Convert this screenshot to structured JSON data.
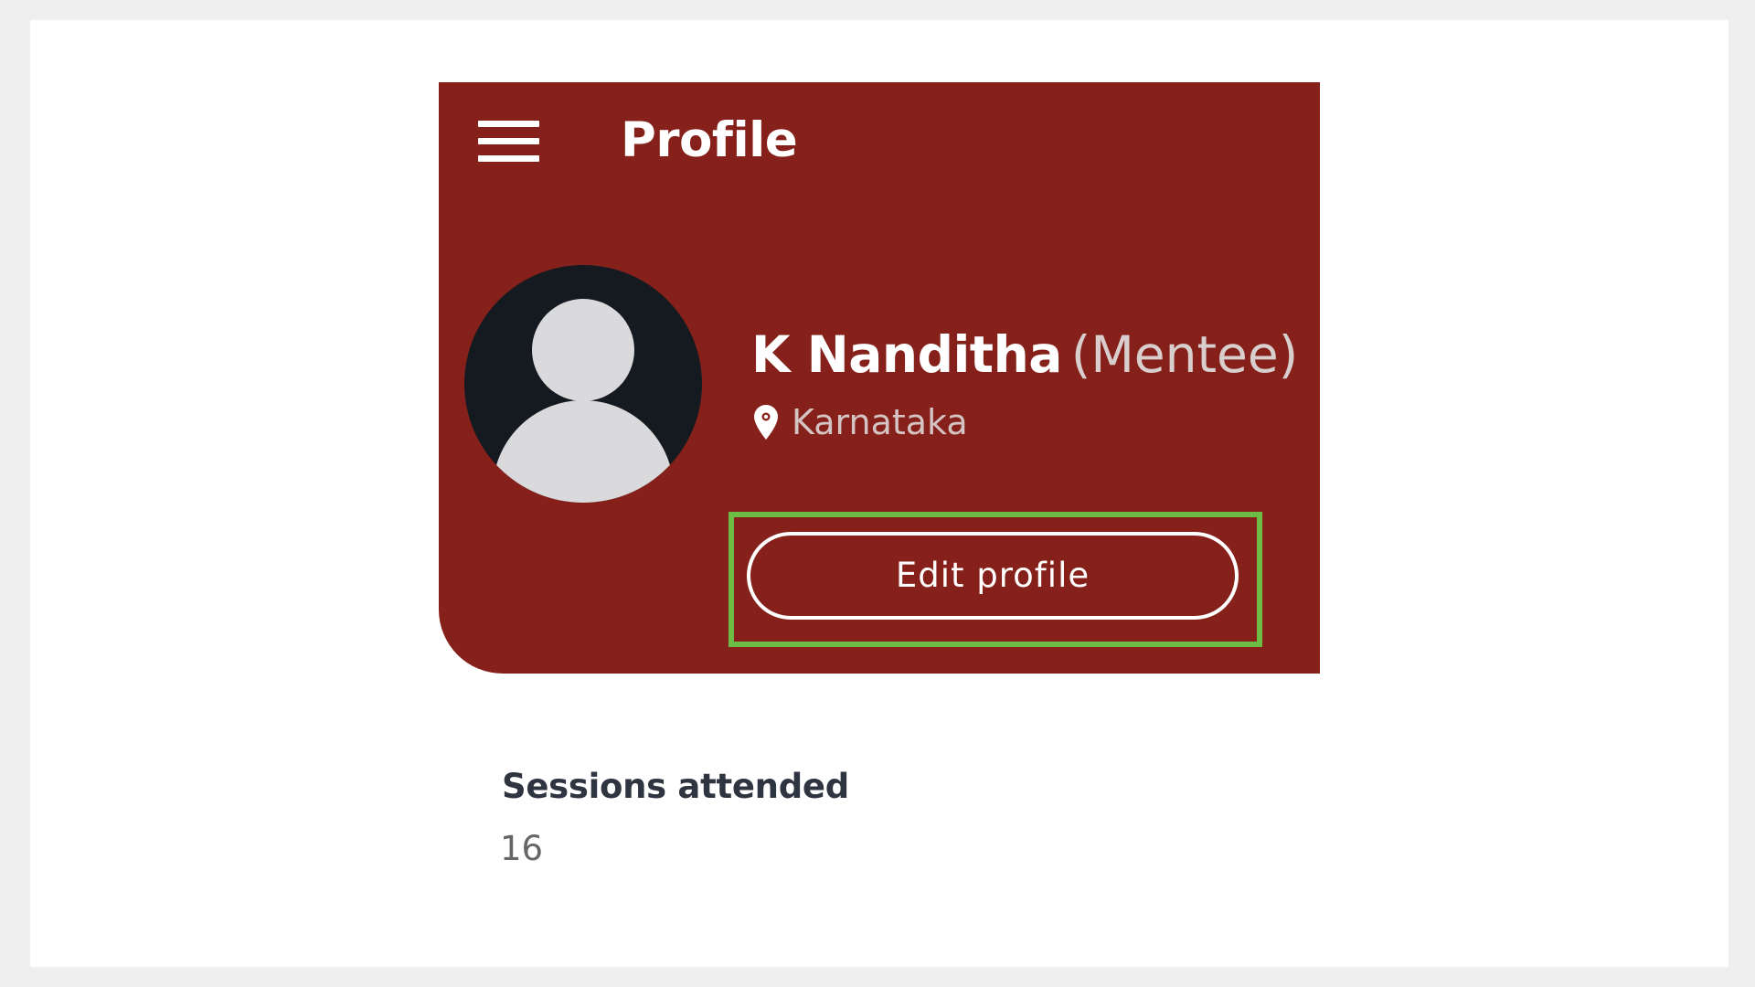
{
  "header": {
    "title": "Profile",
    "menu_icon": "hamburger-menu-icon",
    "background_color": "#85211a"
  },
  "profile": {
    "name": "K Nanditha",
    "role": "(Mentee)",
    "location": "Karnataka",
    "location_icon": "location-pin-icon",
    "avatar_icon": "default-user-avatar-icon",
    "edit_button_label": "Edit profile"
  },
  "stats": {
    "sessions_label": "Sessions attended",
    "sessions_value": "16"
  },
  "colors": {
    "highlight": "#6cbc45",
    "avatar_background": "#151a20",
    "avatar_silhouette": "#dadadc"
  }
}
